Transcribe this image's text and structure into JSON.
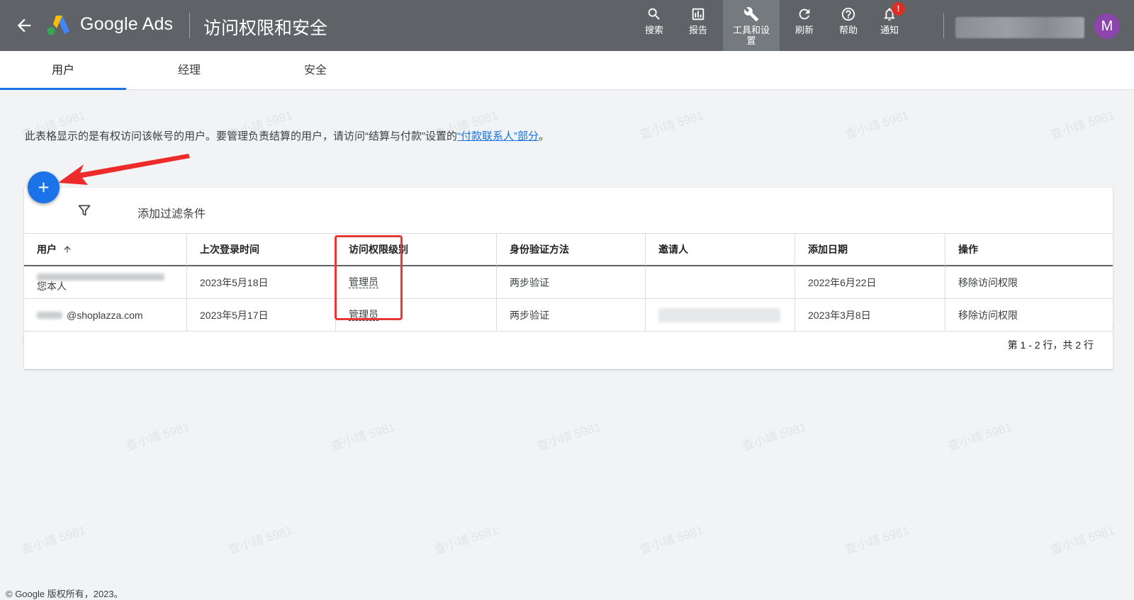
{
  "header": {
    "brand": "Google Ads",
    "page_title": "访问权限和安全",
    "tools": [
      {
        "label": "搜索",
        "icon": "search-icon"
      },
      {
        "label": "报告",
        "icon": "report-icon"
      },
      {
        "label": "工具和设置",
        "icon": "wrench-icon"
      },
      {
        "label": "刷新",
        "icon": "refresh-icon"
      },
      {
        "label": "帮助",
        "icon": "help-icon"
      },
      {
        "label": "通知",
        "icon": "bell-icon"
      }
    ],
    "notification_badge": "!",
    "avatar_letter": "M"
  },
  "tabs": [
    "用户",
    "经理",
    "安全"
  ],
  "description": {
    "text": "此表格显示的是有权访问该帐号的用户。要管理负责结算的用户，请访问“结算与付款”设置的",
    "link": "“付款联系人”部分",
    "suffix": "。"
  },
  "filter": {
    "label": "添加过滤条件"
  },
  "table": {
    "headers": [
      "用户",
      "上次登录时间",
      "访问权限级别",
      "身份验证方法",
      "邀请人",
      "添加日期",
      "操作"
    ],
    "rows": [
      {
        "user_note": "您本人",
        "last_login": "2023年5月18日",
        "access_level": "管理员",
        "auth": "两步验证",
        "added": "2022年6月22日",
        "action": "移除访问权限"
      },
      {
        "user": "@shoplazza.com",
        "last_login": "2023年5月17日",
        "access_level": "管理员",
        "auth": "两步验证",
        "added": "2023年3月8日",
        "action": "移除访问权限"
      }
    ]
  },
  "pagination": "第 1 - 2 行，共 2 行",
  "footer": "© Google 版权所有，2023。",
  "watermark": "查小靖 5981",
  "colors": {
    "topbar": "#5f6368",
    "accent": "#1a73e8",
    "highlight": "#e53935",
    "avatar": "#8e44ad"
  }
}
